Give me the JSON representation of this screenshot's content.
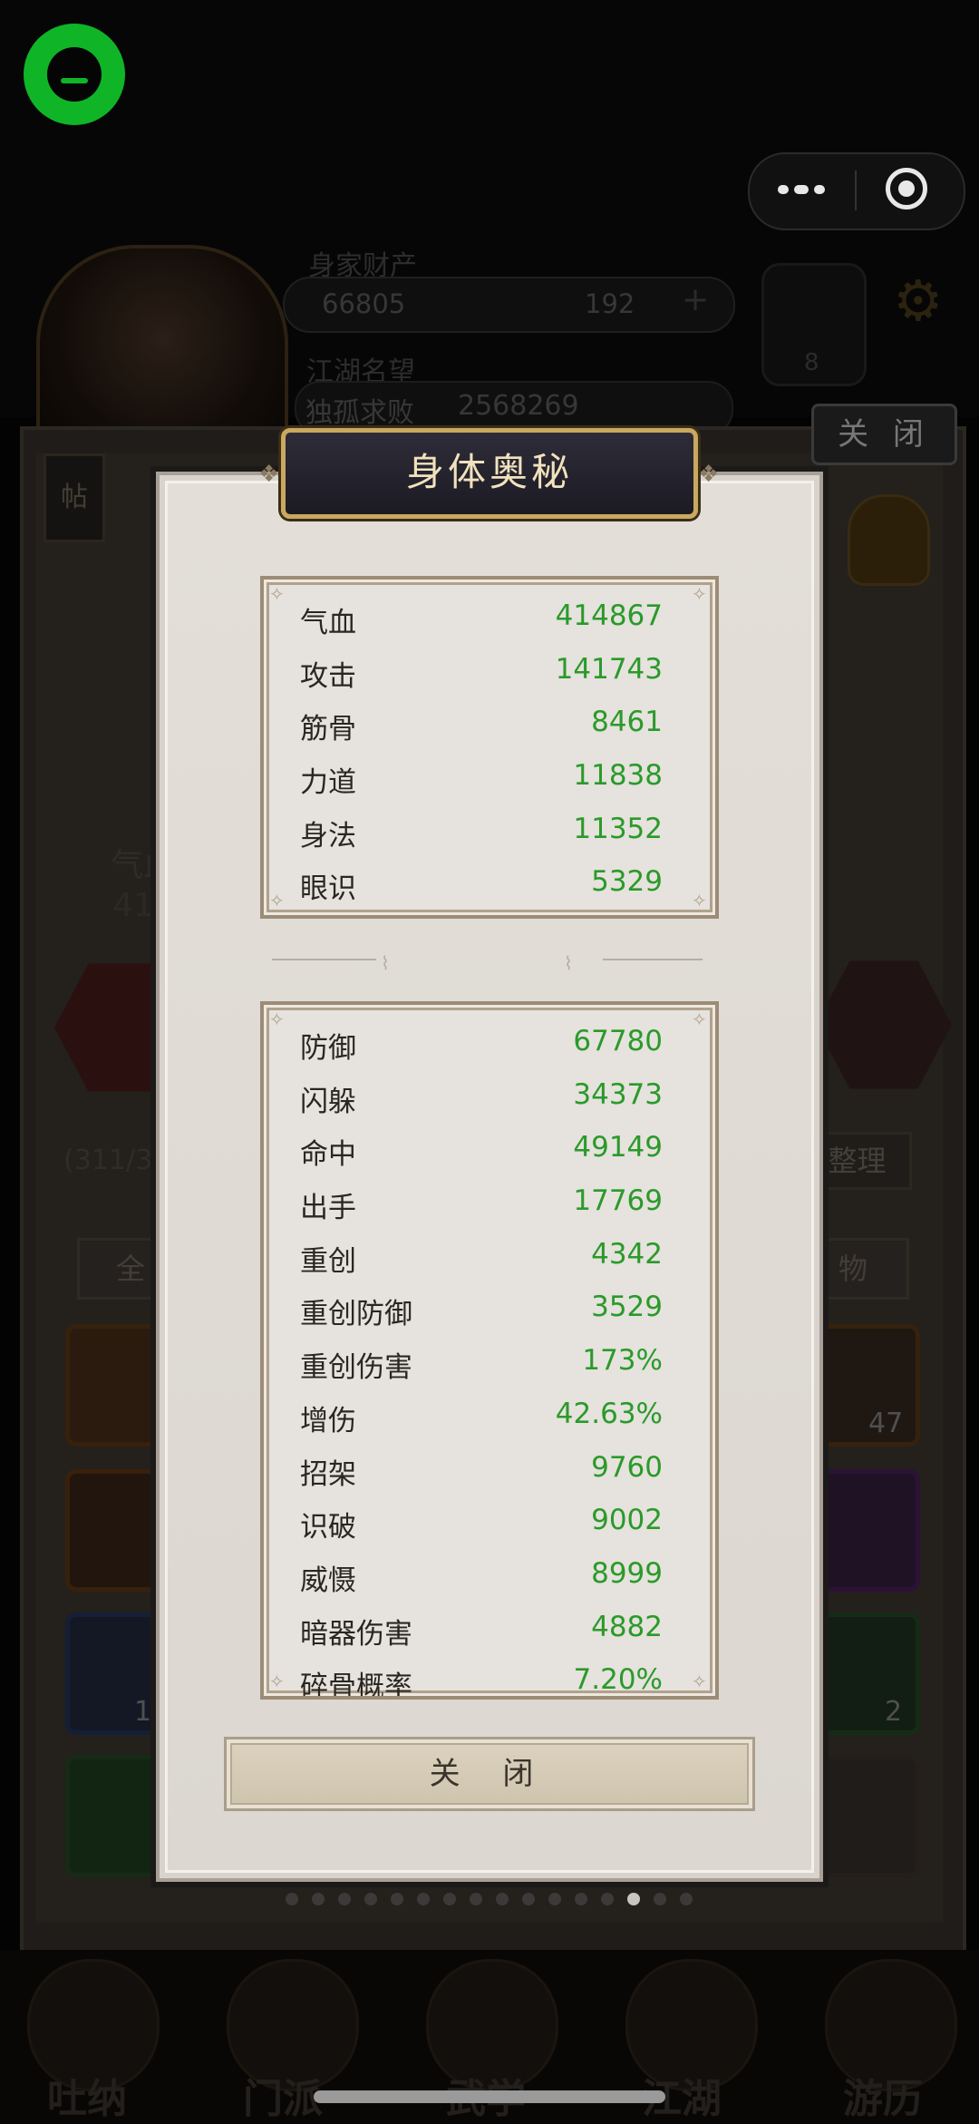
{
  "background": {
    "resources_label": "身家财产",
    "coin_value": "66805",
    "gem_value": "192",
    "plus": "+",
    "fame_label": "江湖名望",
    "fame_title": "独孤求败",
    "fame_value": "2568269",
    "yinyang_value": "8",
    "close_label": "关 闭",
    "tie_label": "帖",
    "left_stat_label": "气血",
    "left_stat_value": "41",
    "bag_count": "(311/38",
    "tidy_label": "整理",
    "tab_all": "全",
    "tab_items": "物",
    "slot_counts": [
      "47",
      "10",
      "2"
    ],
    "nav": [
      "吐纳",
      "门派",
      "武学",
      "江湖",
      "游历"
    ]
  },
  "modal": {
    "title": "身体奥秘",
    "close_button": "关 闭",
    "stats_primary": [
      {
        "name": "气血",
        "value": "414867"
      },
      {
        "name": "攻击",
        "value": "141743"
      },
      {
        "name": "筋骨",
        "value": "8461"
      },
      {
        "name": "力道",
        "value": "11838"
      },
      {
        "name": "身法",
        "value": "11352"
      },
      {
        "name": "眼识",
        "value": "5329"
      }
    ],
    "stats_secondary": [
      {
        "name": "防御",
        "value": "67780"
      },
      {
        "name": "闪躲",
        "value": "34373"
      },
      {
        "name": "命中",
        "value": "49149"
      },
      {
        "name": "出手",
        "value": "17769"
      },
      {
        "name": "重创",
        "value": "4342"
      },
      {
        "name": "重创防御",
        "value": "3529"
      },
      {
        "name": "重创伤害",
        "value": "173%"
      },
      {
        "name": "增伤",
        "value": "42.63%"
      },
      {
        "name": "招架",
        "value": "9760"
      },
      {
        "name": "识破",
        "value": "9002"
      },
      {
        "name": "威慑",
        "value": "8999"
      },
      {
        "name": "暗器伤害",
        "value": "4882"
      },
      {
        "name": "碎骨概率",
        "value": "7.20%"
      }
    ],
    "page_dots_total": 16,
    "page_dots_active": 13
  },
  "colors": {
    "stat_value": "#2a9a2a",
    "title_text": "#f1e2bd",
    "app_logo": "#0fb526"
  },
  "icons": {
    "app_logo": "chat-bubble-icon",
    "menu": "more-dots-icon",
    "close_miniapp": "target-icon"
  }
}
